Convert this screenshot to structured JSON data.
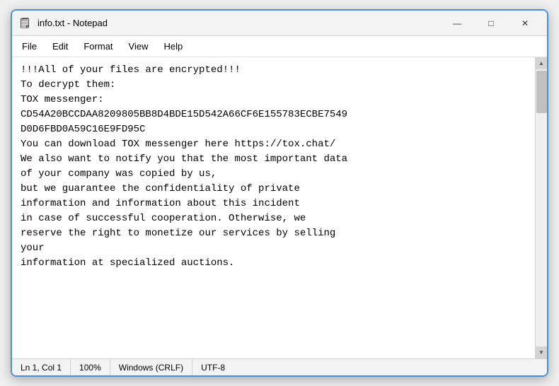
{
  "window": {
    "title": "info.txt - Notepad",
    "icon": "📄"
  },
  "title_controls": {
    "minimize": "—",
    "maximize": "□",
    "close": "✕"
  },
  "menu": {
    "items": [
      {
        "id": "file",
        "label": "File"
      },
      {
        "id": "edit",
        "label": "Edit"
      },
      {
        "id": "format",
        "label": "Format"
      },
      {
        "id": "view",
        "label": "View"
      },
      {
        "id": "help",
        "label": "Help"
      }
    ]
  },
  "content": {
    "text": "!!!All of your files are encrypted!!!\nTo decrypt them:\nTOX messenger:\nCD54A20BCCDAA8209805BB8D4BDE15D542A66CF6E155783ECBE7549\nD0D6FBD0A59C16E9FD95C\nYou can download TOX messenger here https://tox.chat/\nWe also want to notify you that the most important data\nof your company was copied by us,\nbut we guarantee the confidentiality of private\ninformation and information about this incident\nin case of successful cooperation. Otherwise, we\nreserve the right to monetize our services by selling\nyour\ninformation at specialized auctions."
  },
  "status_bar": {
    "position": "Ln 1, Col 1",
    "zoom": "100%",
    "line_ending": "Windows (CRLF)",
    "encoding": "UTF-8"
  }
}
